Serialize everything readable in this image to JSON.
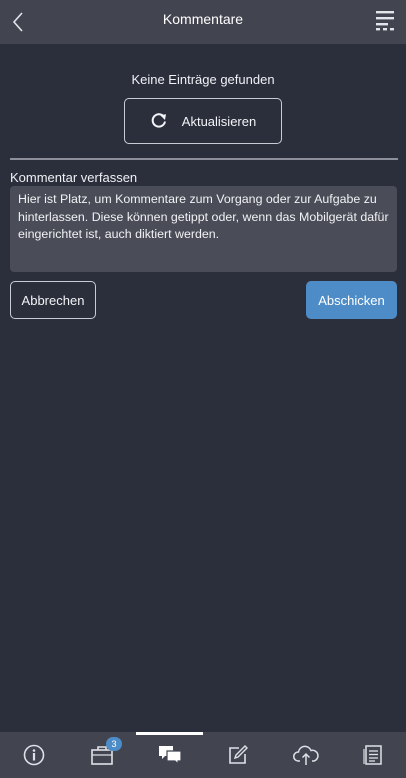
{
  "header": {
    "title": "Kommentare",
    "back_icon": "chevron-left-icon",
    "menu_icon": "menu-lines-icon"
  },
  "list": {
    "empty_message": "Keine Einträge gefunden",
    "refresh_label": "Aktualisieren",
    "refresh_icon": "refresh-icon"
  },
  "compose": {
    "label": "Kommentar verfassen",
    "placeholder": "Hier ist Platz, um Kommentare zum Vorgang oder zur Aufgabe zu hinterlassen. Diese können getippt oder, wenn das Mobilgerät dafür eingerichtet ist, auch diktiert werden.",
    "cancel_label": "Abbrechen",
    "send_label": "Abschicken"
  },
  "tabbar": {
    "tabs": [
      {
        "icon": "info-icon",
        "active": false
      },
      {
        "icon": "briefcase-icon",
        "active": false,
        "badge": "3"
      },
      {
        "icon": "comments-icon",
        "active": true
      },
      {
        "icon": "edit-icon",
        "active": false
      },
      {
        "icon": "cloud-upload-icon",
        "active": false
      },
      {
        "icon": "document-list-icon",
        "active": false
      }
    ]
  },
  "colors": {
    "background": "#2b2e3b",
    "bars": "#424550",
    "accent": "#4d8cc6",
    "field": "#4a4d57"
  }
}
